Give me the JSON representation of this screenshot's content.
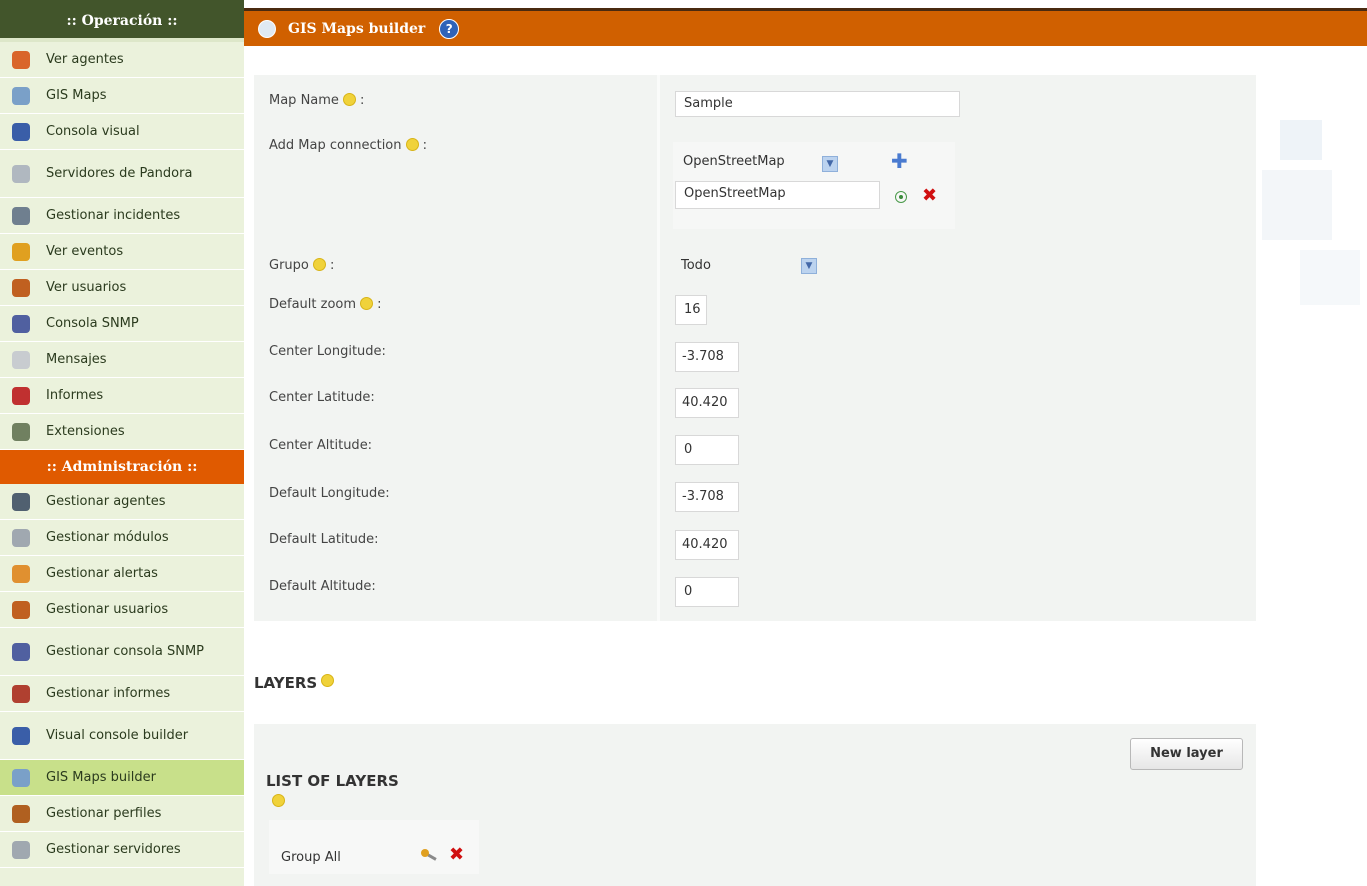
{
  "sidebar": {
    "operation_header": ":: Operación ::",
    "operation_items": [
      {
        "label": "Ver agentes",
        "icon": "agents-icon",
        "color": "#d9662b"
      },
      {
        "label": "GIS Maps",
        "icon": "globe-icon",
        "color": "#7aa0c8"
      },
      {
        "label": "Consola visual",
        "icon": "monitor-icon",
        "color": "#3a5ea8"
      },
      {
        "label": "Servidores de Pandora",
        "icon": "server-icon",
        "color": "#b0b8c0"
      },
      {
        "label": "Gestionar incidentes",
        "icon": "incident-icon",
        "color": "#6f7f8f"
      },
      {
        "label": "Ver eventos",
        "icon": "events-icon",
        "color": "#e0a020"
      },
      {
        "label": "Ver usuarios",
        "icon": "users-icon",
        "color": "#c06020"
      },
      {
        "label": "Consola SNMP",
        "icon": "snmp-icon",
        "color": "#5060a0"
      },
      {
        "label": "Mensajes",
        "icon": "mail-icon",
        "color": "#c8ccd0"
      },
      {
        "label": "Informes",
        "icon": "reports-icon",
        "color": "#c03030"
      },
      {
        "label": "Extensiones",
        "icon": "extensions-icon",
        "color": "#708060"
      }
    ],
    "admin_header": ":: Administración ::",
    "admin_items": [
      {
        "label": "Gestionar agentes",
        "icon": "manage-agents-icon",
        "color": "#506070"
      },
      {
        "label": "Gestionar módulos",
        "icon": "modules-icon",
        "color": "#a0a8b0"
      },
      {
        "label": "Gestionar alertas",
        "icon": "alerts-icon",
        "color": "#e09030"
      },
      {
        "label": "Gestionar usuarios",
        "icon": "manage-users-icon",
        "color": "#c06020"
      },
      {
        "label": "Gestionar consola SNMP",
        "icon": "manage-snmp-icon",
        "color": "#5060a0"
      },
      {
        "label": "Gestionar informes",
        "icon": "manage-reports-icon",
        "color": "#b04030"
      },
      {
        "label": "Visual console builder",
        "icon": "console-builder-icon",
        "color": "#3a5ea8"
      },
      {
        "label": "GIS Maps builder",
        "icon": "globe-icon",
        "color": "#7aa0c8",
        "active": true
      },
      {
        "label": "Gestionar perfiles",
        "icon": "profiles-icon",
        "color": "#b06020"
      },
      {
        "label": "Gestionar servidores",
        "icon": "servers-icon",
        "color": "#a0a8b0"
      }
    ]
  },
  "header": {
    "title": "GIS Maps builder",
    "help": "?"
  },
  "form": {
    "map_name_label": "Map Name",
    "map_name_value": "Sample",
    "add_connection_label": "Add Map connection",
    "connection_select": "OpenStreetMap",
    "connection_value": "OpenStreetMap",
    "group_label": "Grupo",
    "group_value": "Todo",
    "default_zoom_label": "Default zoom",
    "default_zoom_value": "16",
    "center_longitude_label": "Center Longitude:",
    "center_longitude_value": "-3.708",
    "center_latitude_label": "Center Latitude:",
    "center_latitude_value": "40.420",
    "center_altitude_label": "Center Altitude:",
    "center_altitude_value": "0",
    "default_longitude_label": "Default Longitude:",
    "default_longitude_value": "-3.708",
    "default_latitude_label": "Default Latitude:",
    "default_latitude_value": "40.420",
    "default_altitude_label": "Default Altitude:",
    "default_altitude_value": "0",
    "colon": " :"
  },
  "layers": {
    "title": "LAYERS",
    "new_layer_button": "New layer",
    "list_title": "LIST OF LAYERS",
    "group_row_label": "Group All"
  }
}
